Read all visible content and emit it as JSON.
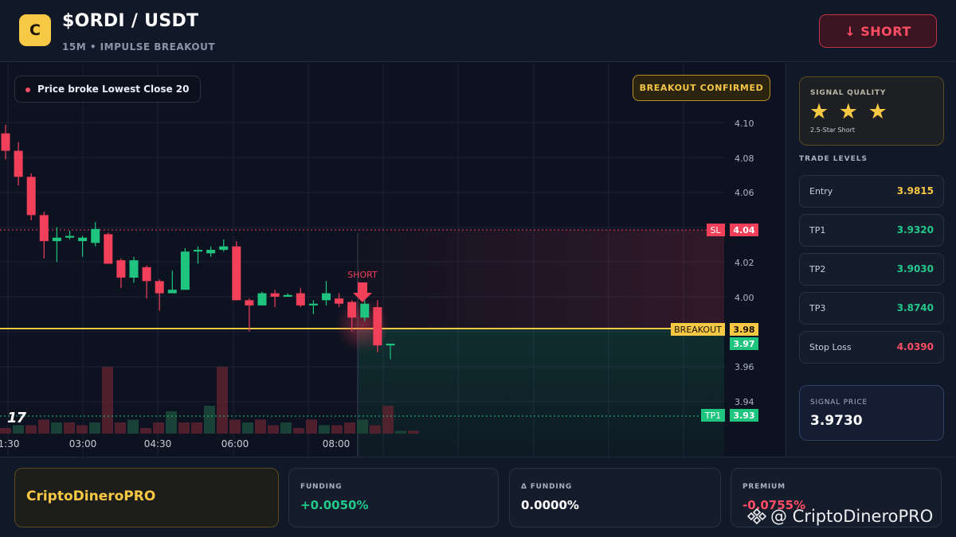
{
  "header": {
    "logo_letter": "C",
    "title": "$ORDI / USDT",
    "subtitle": "15M • IMPULSE BREAKOUT",
    "short_label": "↓ SHORT"
  },
  "chart": {
    "condition_badge": "Price broke Lowest Close 20",
    "confirm_badge": "BREAKOUT CONFIRMED",
    "tv_logo": "17",
    "signal_marker_label": "SHORT",
    "y_ticks": [
      "4.10",
      "4.08",
      "4.06",
      "4.02",
      "4.00",
      "3.96",
      "3.94"
    ],
    "x_ticks": [
      "1:30",
      "03:00",
      "04:30",
      "06:00",
      "08:00"
    ],
    "price_tags": {
      "sl_label": "SL",
      "sl_value": "4.04",
      "breakout_label": "BREAKOUT",
      "breakout_value": "3.98",
      "current_value": "3.97",
      "tp1_label": "TP1",
      "tp1_value": "3.93"
    },
    "colors": {
      "up": "#1fc47e",
      "down": "#f23f5a",
      "breakout": "#f7c843"
    }
  },
  "chart_data": {
    "type": "candlestick",
    "y_range": [
      3.925,
      4.115
    ],
    "candles": [
      {
        "o": 4.095,
        "h": 4.1,
        "c": 4.085,
        "l": 4.08
      },
      {
        "o": 4.085,
        "h": 4.09,
        "c": 4.07,
        "l": 4.065
      },
      {
        "o": 4.07,
        "h": 4.072,
        "c": 4.048,
        "l": 4.045
      },
      {
        "o": 4.048,
        "h": 4.05,
        "c": 4.033,
        "l": 4.023
      },
      {
        "o": 4.033,
        "h": 4.041,
        "c": 4.035,
        "l": 4.021
      },
      {
        "o": 4.035,
        "h": 4.039,
        "c": 4.036,
        "l": 4.034
      },
      {
        "o": 4.033,
        "h": 4.036,
        "c": 4.035,
        "l": 4.024
      },
      {
        "o": 4.032,
        "h": 4.044,
        "c": 4.04,
        "l": 4.03
      },
      {
        "o": 4.037,
        "h": 4.038,
        "c": 4.02,
        "l": 4.02
      },
      {
        "o": 4.022,
        "h": 4.023,
        "c": 4.012,
        "l": 4.006
      },
      {
        "o": 4.012,
        "h": 4.024,
        "c": 4.022,
        "l": 4.009
      },
      {
        "o": 4.018,
        "h": 4.019,
        "c": 4.01,
        "l": 4.0
      },
      {
        "o": 4.01,
        "h": 4.011,
        "c": 4.003,
        "l": 3.993
      },
      {
        "o": 4.003,
        "h": 4.016,
        "c": 4.005,
        "l": 4.004
      },
      {
        "o": 4.005,
        "h": 4.029,
        "c": 4.027,
        "l": 4.006
      },
      {
        "o": 4.027,
        "h": 4.03,
        "c": 4.028,
        "l": 4.02
      },
      {
        "o": 4.026,
        "h": 4.03,
        "c": 4.028,
        "l": 4.024
      },
      {
        "o": 4.028,
        "h": 4.034,
        "c": 4.03,
        "l": 4.027
      },
      {
        "o": 4.03,
        "h": 4.033,
        "c": 3.999,
        "l": 3.999
      },
      {
        "o": 3.999,
        "h": 4.0,
        "c": 3.996,
        "l": 3.981
      },
      {
        "o": 3.996,
        "h": 4.004,
        "c": 4.003,
        "l": 3.996
      },
      {
        "o": 4.003,
        "h": 4.005,
        "c": 4.001,
        "l": 3.995
      },
      {
        "o": 4.001,
        "h": 4.003,
        "c": 4.002,
        "l": 4.001
      },
      {
        "o": 4.003,
        "h": 4.006,
        "c": 3.996,
        "l": 3.995
      },
      {
        "o": 3.996,
        "h": 3.999,
        "c": 3.997,
        "l": 3.991
      },
      {
        "o": 3.999,
        "h": 4.01,
        "c": 4.003,
        "l": 3.996
      },
      {
        "o": 4.0,
        "h": 4.003,
        "c": 3.997,
        "l": 3.995
      },
      {
        "o": 3.998,
        "h": 3.999,
        "c": 3.989,
        "l": 3.981
      },
      {
        "o": 3.989,
        "h": 3.999,
        "c": 3.997,
        "l": 3.987
      },
      {
        "o": 3.995,
        "h": 3.999,
        "c": 3.973,
        "l": 3.969
      },
      {
        "o": 3.973,
        "h": 3.974,
        "c": 3.974,
        "l": 3.965
      }
    ],
    "volumes": [
      1,
      1.5,
      1.5,
      2.5,
      2,
      2,
      1.5,
      2,
      12,
      2,
      2.5,
      1,
      2,
      4,
      2,
      2,
      5,
      12,
      2.5,
      2,
      2.5,
      1.5,
      2,
      1,
      2.5,
      1.5,
      1.5,
      2,
      2.5,
      1.5,
      5,
      0.5,
      0.5
    ]
  },
  "panel": {
    "quality_label": "SIGNAL QUALITY",
    "stars": "★ ★ ★",
    "quality_sub": "2.5-Star Short",
    "levels_title": "TRADE LEVELS",
    "levels": [
      {
        "name": "Entry",
        "value": "3.9815",
        "color": "#f7c843"
      },
      {
        "name": "TP1",
        "value": "3.9320",
        "color": "#22c98a"
      },
      {
        "name": "TP2",
        "value": "3.9030",
        "color": "#22c98a"
      },
      {
        "name": "TP3",
        "value": "3.8740",
        "color": "#22c98a"
      },
      {
        "name": "Stop Loss",
        "value": "4.0390",
        "color": "#ff4e64"
      }
    ],
    "signal_price_label": "SIGNAL PRICE",
    "signal_price_value": "3.9730"
  },
  "footer": {
    "brand": "CriptoDineroPRO",
    "funding_label": "FUNDING",
    "funding_value": "+0.0050%",
    "delta_funding_label": "Δ FUNDING",
    "delta_funding_value": "0.0000%",
    "premium_label": "PREMIUM",
    "premium_value": "-0.0755%",
    "watermark": "@ CriptoDineroPRO"
  }
}
